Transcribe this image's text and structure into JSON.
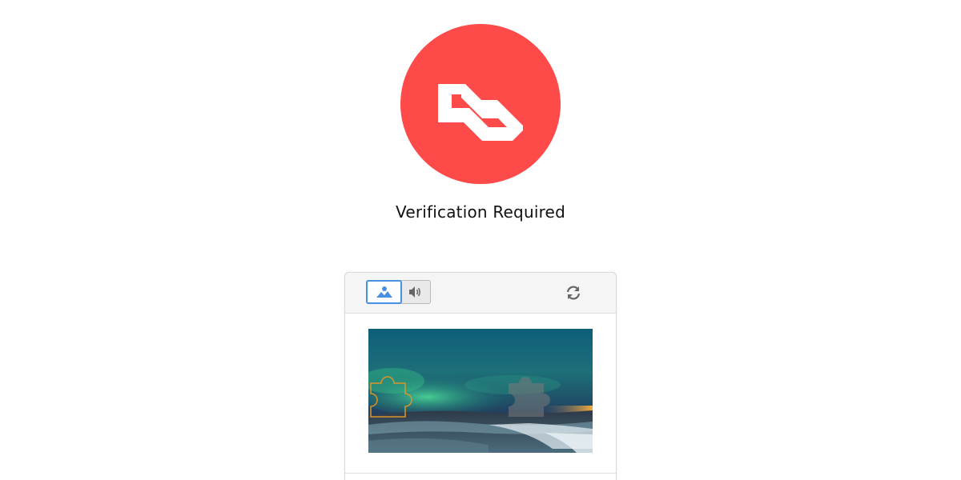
{
  "page": {
    "title": "Verification Required"
  },
  "logo": {
    "icon": "brand-logo-icon",
    "color": "#fe4a49"
  },
  "captcha": {
    "modes": [
      {
        "icon": "image-icon",
        "selected": true
      },
      {
        "icon": "speaker-icon",
        "selected": false
      }
    ],
    "refresh_icon": "refresh-icon",
    "accent_color": "#4a90e2",
    "piece_outline_color": "#d9962a"
  }
}
